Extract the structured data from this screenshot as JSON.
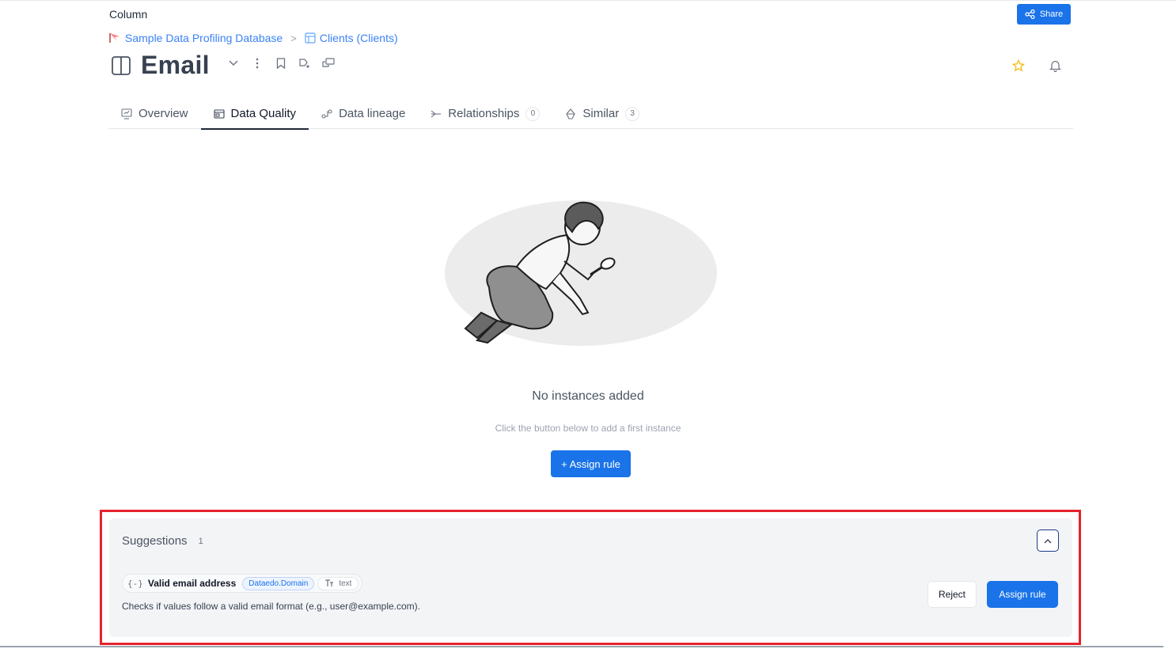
{
  "header": {
    "entity_type": "Column",
    "share_label": "Share",
    "title": "Email"
  },
  "breadcrumb": [
    {
      "label": "Sample Data Profiling Database",
      "icon": "database-flag-icon"
    },
    {
      "label": "Clients (Clients)",
      "icon": "table-icon"
    }
  ],
  "breadcrumb_separator": ">",
  "tabs": [
    {
      "label": "Overview",
      "icon": "overview-icon",
      "active": false
    },
    {
      "label": "Data Quality",
      "icon": "data-quality-icon",
      "active": true
    },
    {
      "label": "Data lineage",
      "icon": "lineage-icon",
      "active": false
    },
    {
      "label": "Relationships",
      "icon": "relationships-icon",
      "count": "0",
      "active": false
    },
    {
      "label": "Similar",
      "icon": "similar-icon",
      "count": "3",
      "active": false
    }
  ],
  "empty_state": {
    "title": "No instances added",
    "subtitle": "Click the button below to add a first instance",
    "button_label": "+ Assign rule"
  },
  "suggestions": {
    "title": "Suggestions",
    "count": "1",
    "items": [
      {
        "brace": "{-}",
        "name": "Valid email address",
        "domain": "Dataedo.Domain",
        "type": "text",
        "description": "Checks if values follow a valid email format (e.g., user@example.com).",
        "reject_label": "Reject",
        "assign_label": "Assign rule"
      }
    ]
  },
  "colors": {
    "primary": "#1a73e8",
    "highlight": "#e5222c",
    "star": "#f5b800"
  }
}
